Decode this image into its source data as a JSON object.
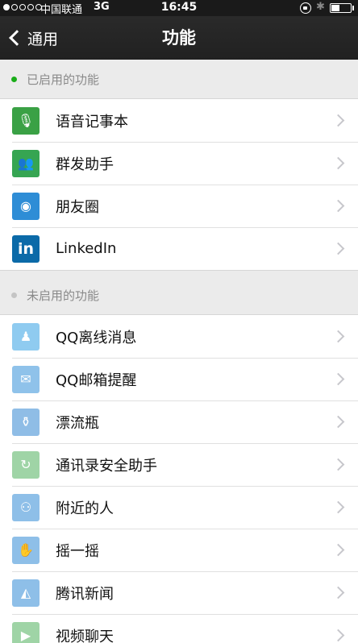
{
  "status_bar": {
    "carrier": "中国联通",
    "network": "3G",
    "time": "16:45",
    "bluetooth_glyph": "✱",
    "battery_level": 0.45
  },
  "nav": {
    "back_label": "通用",
    "title": "功能"
  },
  "sections": [
    {
      "header": "已启用的功能",
      "dot_color": "#1aad19",
      "items": [
        {
          "label": "语音记事本",
          "icon": "voice-notepad-icon",
          "glyph": "🎙",
          "color": "#3aa145"
        },
        {
          "label": "群发助手",
          "icon": "broadcast-assistant-icon",
          "glyph": "👥",
          "color": "#36a552"
        },
        {
          "label": "朋友圈",
          "icon": "moments-icon",
          "glyph": "◉",
          "color": "#2e8dd6"
        },
        {
          "label": "LinkedIn",
          "icon": "linkedin-icon",
          "glyph": "in",
          "color": "#0b6aa8"
        }
      ]
    },
    {
      "header": "未启用的功能",
      "dot_color": "#c4c4c4",
      "items": [
        {
          "label": "QQ离线消息",
          "icon": "qq-offline-icon",
          "glyph": "♟",
          "color": "#8fcbf0"
        },
        {
          "label": "QQ邮箱提醒",
          "icon": "qq-mail-icon",
          "glyph": "✉",
          "color": "#8fc2ea"
        },
        {
          "label": "漂流瓶",
          "icon": "drift-bottle-icon",
          "glyph": "⚱",
          "color": "#8fbde6"
        },
        {
          "label": "通讯录安全助手",
          "icon": "contacts-security-icon",
          "glyph": "↻",
          "color": "#9fd4a6"
        },
        {
          "label": "附近的人",
          "icon": "people-nearby-icon",
          "glyph": "⚇",
          "color": "#8ebfe8"
        },
        {
          "label": "摇一摇",
          "icon": "shake-icon",
          "glyph": "✋",
          "color": "#8ebfe8"
        },
        {
          "label": "腾讯新闻",
          "icon": "tencent-news-icon",
          "glyph": "◭",
          "color": "#8ebfe8"
        },
        {
          "label": "视频聊天",
          "icon": "video-chat-icon",
          "glyph": "▶",
          "color": "#9fd4a6"
        }
      ]
    }
  ]
}
